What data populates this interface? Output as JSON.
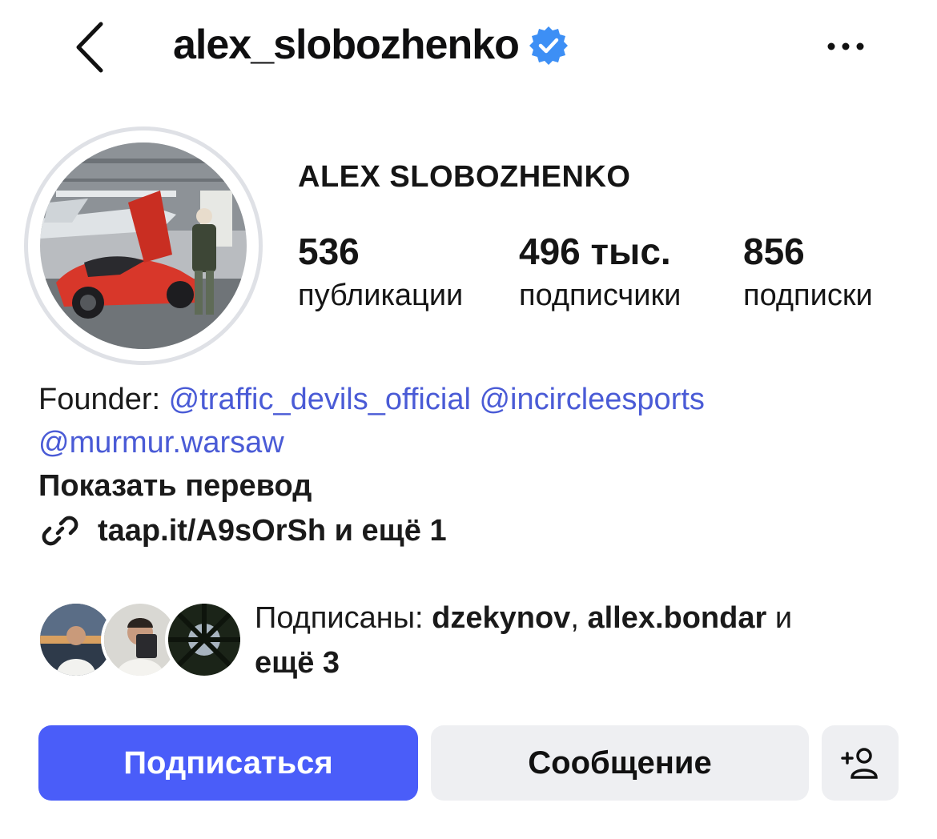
{
  "header": {
    "back_icon": "chevron-left-icon",
    "username": "alex_slobozhenko",
    "verified_icon": "verified-badge-icon",
    "more_icon": "more-horizontal-icon"
  },
  "profile": {
    "full_name": "ALEX SLOBOZHENKO",
    "stats": {
      "posts_value": "536",
      "posts_label": "публикации",
      "followers_value": "496 тыс.",
      "followers_label": "подписчики",
      "following_value": "856",
      "following_label": "подписки"
    }
  },
  "bio": {
    "prefix": "Founder: ",
    "mention1": "@traffic_devils_official",
    "mention2": "@incircleesports",
    "mention3": "@murmur.warsaw",
    "translate": "Показать перевод",
    "link_icon": "link-icon",
    "link_text": "taap.it/A9sOrSh и ещё 1"
  },
  "followed_by": {
    "prefix": "Подписаны: ",
    "user1": "dzekynov",
    "separator": ", ",
    "user2": "allex.bondar",
    "middle": " и ",
    "more": "ещё 3"
  },
  "actions": {
    "follow_label": "Подписаться",
    "message_label": "Сообщение",
    "add_person_icon": "add-person-icon"
  },
  "colors": {
    "accent": "#4a5df9",
    "mention": "#4a5bd6",
    "verified": "#3d8ff5",
    "secondary_button": "#eeeff2"
  }
}
